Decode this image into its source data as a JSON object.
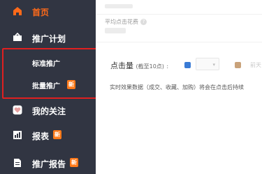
{
  "sidebar": {
    "items": [
      {
        "label": "首页",
        "icon": "home-icon",
        "active": true
      },
      {
        "label": "推广计划",
        "icon": "briefcase-icon"
      },
      {
        "label": "我的关注",
        "icon": "heart-icon"
      },
      {
        "label": "报表",
        "icon": "report-icon",
        "badge": "新"
      },
      {
        "label": "推广报告",
        "icon": "document-icon",
        "badge": "新"
      }
    ],
    "subitems": [
      {
        "label": "标准推广"
      },
      {
        "label": "批量推广",
        "badge": "新"
      }
    ]
  },
  "main": {
    "metric_label": "平均点击花费",
    "help_glyph": "?",
    "click_title": "点击量",
    "click_sub": "(截至10点)",
    "colon": ":",
    "select_arrow": "▾",
    "right_faint": "前天",
    "notice": "实时效果数据（成交、收藏、加购）将会在点击后持续"
  },
  "colors": {
    "sidebar_bg": "#313542",
    "accent": "#ff6a1a",
    "highlight": "#e02020",
    "series1": "#3a7bd5",
    "series2": "#c9a27a"
  }
}
